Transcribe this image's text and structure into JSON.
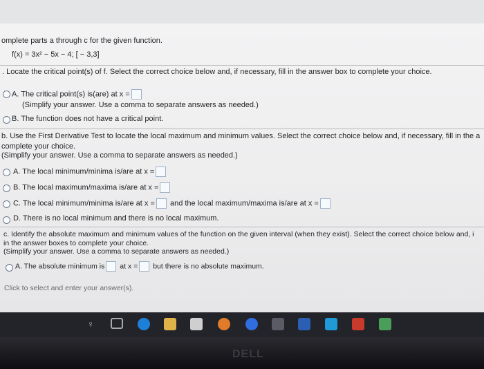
{
  "header": "omplete parts a through c for the given function.",
  "function": "f(x) = 3x² − 5x − 4; [ − 3,3]",
  "part_a": {
    "prompt": ". Locate the critical point(s) of f. Select the correct choice below and, if necessary, fill in the answer box to complete your choice.",
    "options": [
      {
        "letter": "A.",
        "text": "The critical point(s) is(are) at x =",
        "hint": "(Simplify your answer. Use a comma to separate answers as needed.)"
      },
      {
        "letter": "B.",
        "text": "The function does not have a critical point."
      }
    ]
  },
  "part_b": {
    "prompt": "b. Use the First Derivative Test to locate the local maximum and minimum values. Select the correct choice below and, if necessary, fill in the a",
    "prompt2": "complete your choice.",
    "hint": "(Simplify your answer. Use a comma to separate answers as needed.)",
    "options": [
      {
        "letter": "A.",
        "text": "The local minimum/minima is/are at x ="
      },
      {
        "letter": "B.",
        "text": "The local maximum/maxima is/are at x ="
      },
      {
        "letter": "C.",
        "text": "The local minimum/minima is/are at x =",
        "text2": "and the local maximum/maxima is/are at x ="
      },
      {
        "letter": "D.",
        "text": "There is no local minimum and there is no local maximum."
      }
    ]
  },
  "part_c": {
    "prompt": "c. Identify the absolute maximum and minimum values of the function on the given interval (when they exist). Select the correct choice below and, i",
    "prompt2": "in the answer boxes to complete your choice.",
    "hint": "(Simplify your answer. Use a comma to separate answers as needed.)",
    "option_a": {
      "letter": "A.",
      "t1": "The absolute minimum is",
      "t2": "at x =",
      "t3": "but there is no absolute maximum."
    }
  },
  "footer": "Click to select and enter your answer(s).",
  "brand": "DELL"
}
